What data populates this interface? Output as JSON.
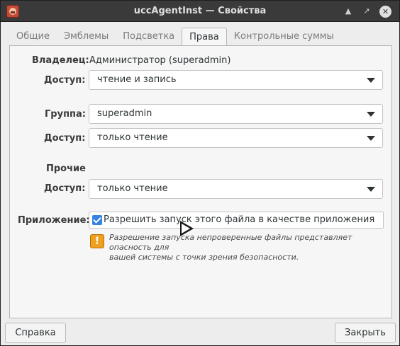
{
  "window": {
    "title": "uccAgentInst — Свойства"
  },
  "tabs": [
    {
      "label": "Общие",
      "active": false
    },
    {
      "label": "Эмблемы",
      "active": false
    },
    {
      "label": "Подсветка",
      "active": false
    },
    {
      "label": "Права",
      "active": true
    },
    {
      "label": "Контрольные суммы",
      "active": false
    }
  ],
  "owner": {
    "label": "Владелец:",
    "value": "Администратор (superadmin)",
    "access_label": "Доступ:",
    "access_value": "чтение и запись"
  },
  "group": {
    "label": "Группа:",
    "value": "superadmin",
    "access_label": "Доступ:",
    "access_value": "только чтение"
  },
  "others": {
    "label": "Прочие",
    "access_label": "Доступ:",
    "access_value": "только чтение"
  },
  "application": {
    "label": "Приложение:",
    "checkbox_label": "Разрешить запуск этого файла в качестве приложения",
    "checked": true,
    "warning_line1": "Разрешение запуска непроверенные файлы представляет опасность для",
    "warning_line2": "вашей системы с точки зрения безопасности."
  },
  "footer": {
    "help_label": "Справка",
    "close_label": "Закрыть"
  },
  "colors": {
    "accent": "#3584e4",
    "titlebar": "#3a3a3a",
    "warning": "#f0a020"
  }
}
